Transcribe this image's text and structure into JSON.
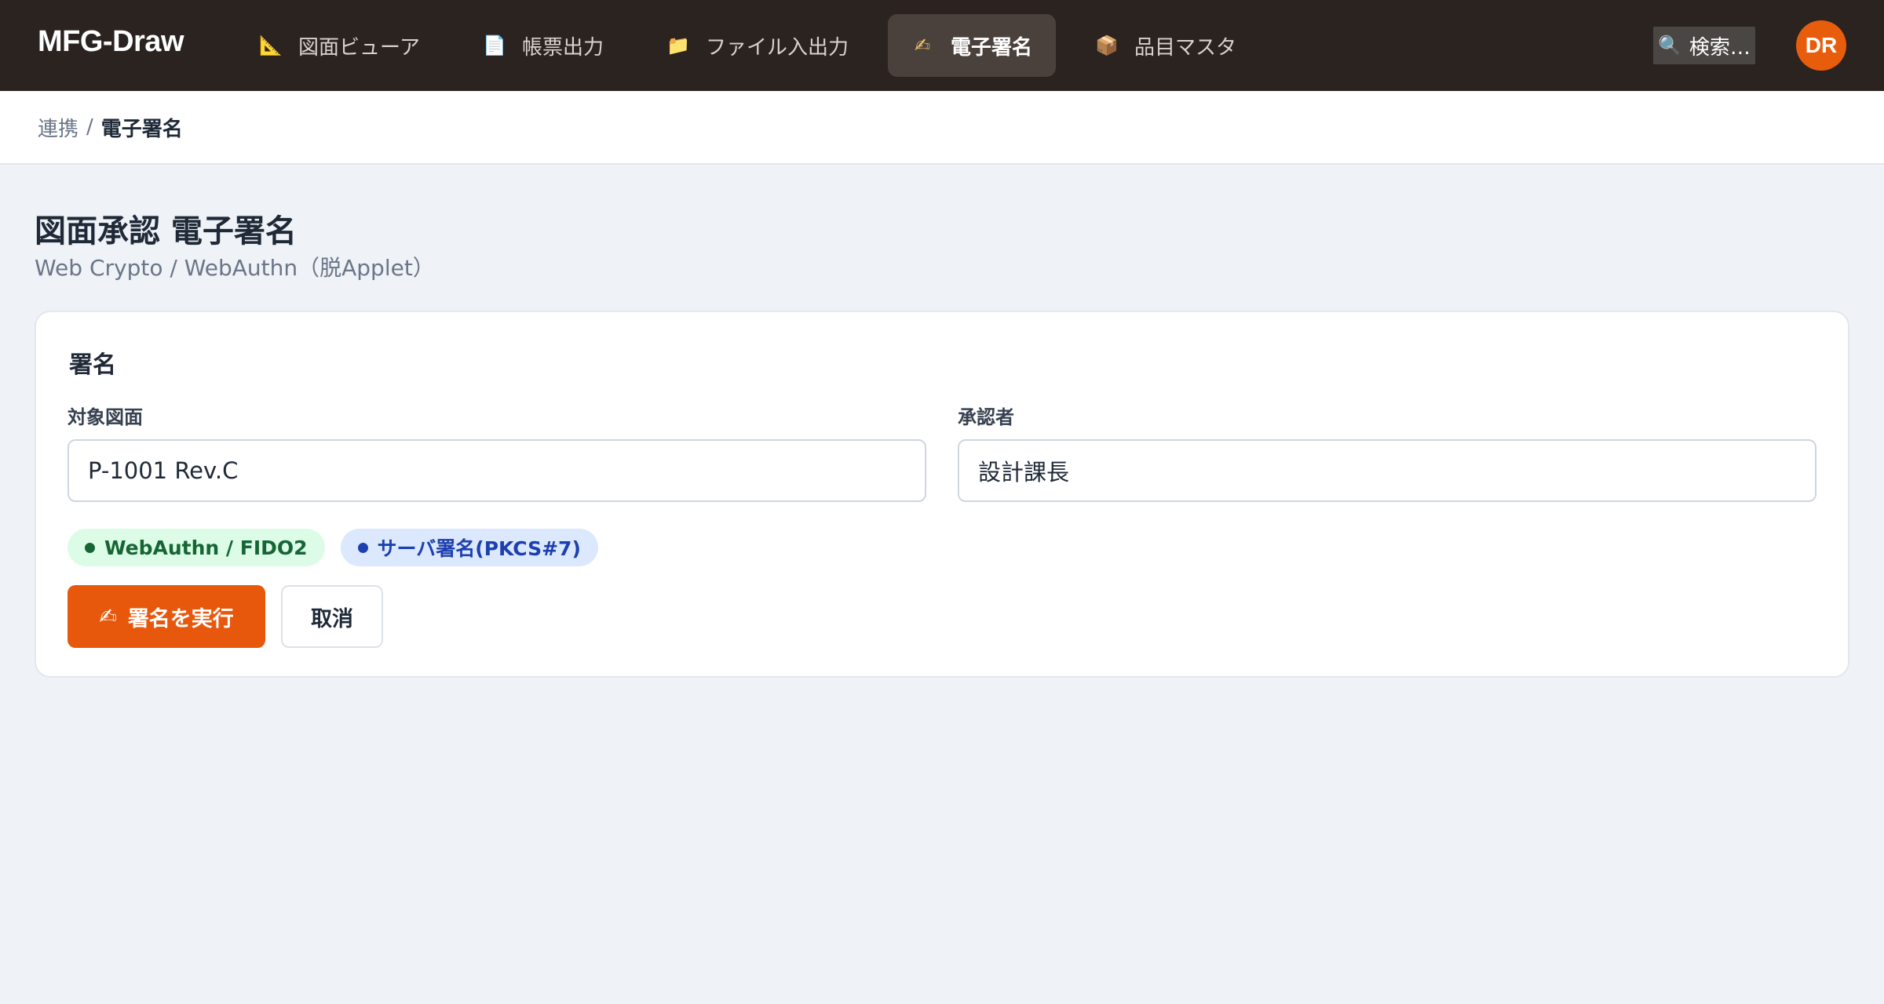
{
  "app": {
    "brand": "MFG-Draw"
  },
  "nav": {
    "items": [
      {
        "icon": "📐",
        "label": "図面ビューア",
        "icon_name": "ruler-triangle-icon"
      },
      {
        "icon": "📄",
        "label": "帳票出力",
        "icon_name": "document-icon"
      },
      {
        "icon": "📁",
        "label": "ファイル入出力",
        "icon_name": "folder-icon"
      },
      {
        "icon": "✍",
        "label": "電子署名",
        "icon_name": "writing-hand-icon",
        "active": true
      },
      {
        "icon": "📦",
        "label": "品目マスタ",
        "icon_name": "package-icon"
      }
    ]
  },
  "search": {
    "icon": "🔍",
    "placeholder": "検索…"
  },
  "user": {
    "initials": "DR",
    "color": "#e85d0c"
  },
  "breadcrumb": {
    "parent": "連携",
    "separator": "/",
    "current": "電子署名"
  },
  "page": {
    "title": "図面承認 電子署名",
    "subtitle": "Web Crypto / WebAuthn（脱Applet）"
  },
  "card": {
    "title": "署名",
    "fields": {
      "drawing": {
        "label": "対象図面",
        "value": "P-1001 Rev.C"
      },
      "approver": {
        "label": "承認者",
        "value": "設計課長"
      }
    },
    "badges": [
      {
        "label": "WebAuthn / FIDO2",
        "color": "#166534"
      },
      {
        "label": "サーバ署名(PKCS#7)",
        "color": "#1e40af"
      }
    ],
    "actions": {
      "sign_icon": "✍",
      "sign_label": "署名を実行",
      "cancel_label": "取消"
    }
  },
  "colors": {
    "topbar": "#2b2320",
    "accent": "#e8580c",
    "background": "#eff2f7"
  }
}
